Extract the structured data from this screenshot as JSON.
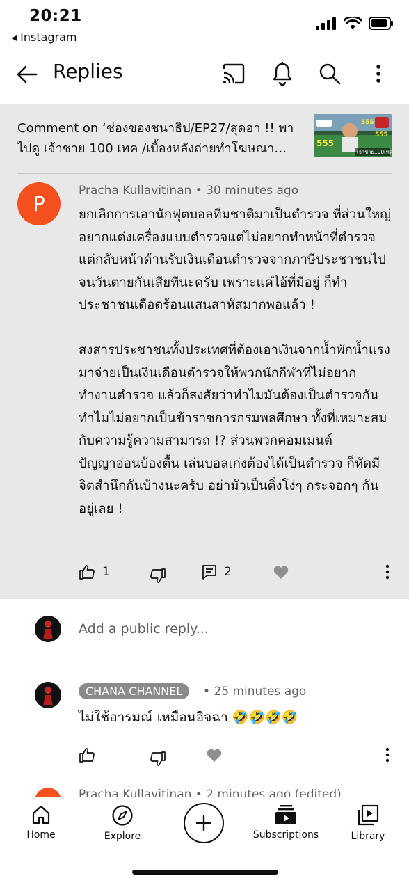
{
  "status_bar": {
    "time": "20:21",
    "back_app": "◂ Instagram"
  },
  "header": {
    "title": "Replies",
    "back_icon": "arrow-left-icon",
    "actions": [
      "cast-icon",
      "bell-icon",
      "search-icon",
      "more-vert-icon"
    ]
  },
  "video": {
    "reference_text": "Comment on ‘ช่องของชนาธิป/EP27/สุดฮา !! พาไปดู เจ้าชาย 100 เทค /เบื้องหลังถ่ายทำโฆษณา…",
    "thumbnail_badges": [
      "555",
      "555",
      "555"
    ],
    "thumbnail_caption": "เจ้าชาย100เทค"
  },
  "comment": {
    "avatar_letter": "P",
    "author": "Pracha Kullavitinan",
    "separator": "•",
    "time": "30 minutes ago",
    "text": "ยกเลิกการเอานักฟุตบอลทีมชาติมาเป็นตำรวจ ที่ส่วนใหญ่อยากแต่งเครื่องแบบตำรวจแต่ไม่อยากทำหน้าที่ตำรวจ แต่กลับหน้าด้านรับเงินเดือนตำรวจจากภาษีประชาชนไปจนวันตายกันเสียทีนะครับ เพราะแค่ไอ้ที่มีอยู่ ก็ทำประชาชนเดือดร้อนแสนสาหัสมากพอแล้ว !\n\nสงสารประชาชนทั้งประเทศที่ต้องเอาเงินจากน้ำพักน้ำแรงมาจ่ายเป็นเงินเดือนตำรวจให้พวกนักกีฬาที่ไม่อยากทำงานตำรวจ แล้วก็สงสัยว่าทำไมมันต้องเป็นตำรวจกัน ทำไมไม่อยากเป็นข้าราชการกรมพลศึกษา ทั้งที่เหมาะสมกับความรู้ความสามารถ !? ส่วนพวกคอมเมนต์ปัญญาอ่อนบ้องตื้น เล่นบอลเก่งต้องได้เป็นตำรวจ ก็หัดมีจิตสำนึกกันบ้างนะครับ อย่ามัวเป็นติ่งโง่ๆ กระจอกๆ กันอยู่เลย !",
    "like_count": "1",
    "reply_count": "2"
  },
  "reply_input": {
    "placeholder": "Add a public reply..."
  },
  "replies": [
    {
      "author": "CHANA CHANNEL",
      "separator": "•",
      "time": "25 minutes ago",
      "text": "ไม่ใช้อารมณ์ เหมือนอิจฉา 🤣🤣🤣🤣"
    }
  ],
  "peek_reply": {
    "text": "Pracha Kullavitinan • 2 minutes ago (edited)"
  },
  "bottom_nav": {
    "home": "Home",
    "explore": "Explore",
    "subscriptions": "Subscriptions",
    "library": "Library"
  },
  "colors": {
    "avatar": "#f4511e",
    "comment_bg": "#e8e8e8",
    "badge": "#8b8b8b"
  }
}
